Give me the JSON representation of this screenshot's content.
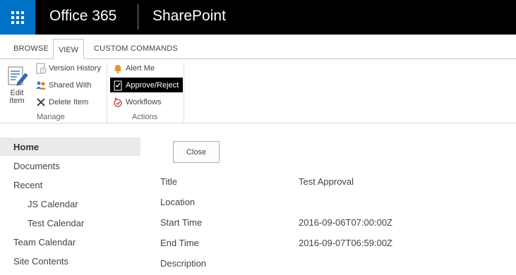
{
  "suite": {
    "brand": "Office 365",
    "app_title": "SharePoint"
  },
  "ribbon": {
    "tabs": [
      {
        "label": "BROWSE"
      },
      {
        "label": "VIEW"
      },
      {
        "label": "CUSTOM COMMANDS"
      }
    ],
    "active_tab": "VIEW",
    "manage": {
      "edit_item_line1": "Edit",
      "edit_item_line2": "Item",
      "version_history": "Version History",
      "shared_with": "Shared With",
      "delete_item": "Delete Item",
      "group_label": "Manage"
    },
    "actions": {
      "alert_me": "Alert Me",
      "approve_reject": "Approve/Reject",
      "workflows": "Workflows",
      "group_label": "Actions"
    }
  },
  "nav": {
    "items": [
      {
        "label": "Home",
        "selected": true
      },
      {
        "label": "Documents"
      },
      {
        "label": "Recent"
      },
      {
        "label": "JS Calendar",
        "indent": true
      },
      {
        "label": "Test Calendar",
        "indent": true
      },
      {
        "label": "Team Calendar"
      },
      {
        "label": "Site Contents"
      }
    ]
  },
  "form": {
    "close_label": "Close",
    "fields": [
      {
        "label": "Title",
        "value": "Test Approval"
      },
      {
        "label": "Location",
        "value": ""
      },
      {
        "label": "Start Time",
        "value": "2016-09-06T07:00:00Z"
      },
      {
        "label": "End Time",
        "value": "2016-09-07T06:59:00Z"
      },
      {
        "label": "Description",
        "value": ""
      }
    ]
  },
  "colors": {
    "suite_bar": "#000000",
    "waffle": "#0072c6",
    "nav_selected": "#eaeaea"
  },
  "icons": [
    "app-launcher-icon",
    "edit-item-icon",
    "version-history-icon",
    "shared-with-icon",
    "delete-icon",
    "alert-bell-icon",
    "approve-reject-icon",
    "workflows-icon"
  ]
}
